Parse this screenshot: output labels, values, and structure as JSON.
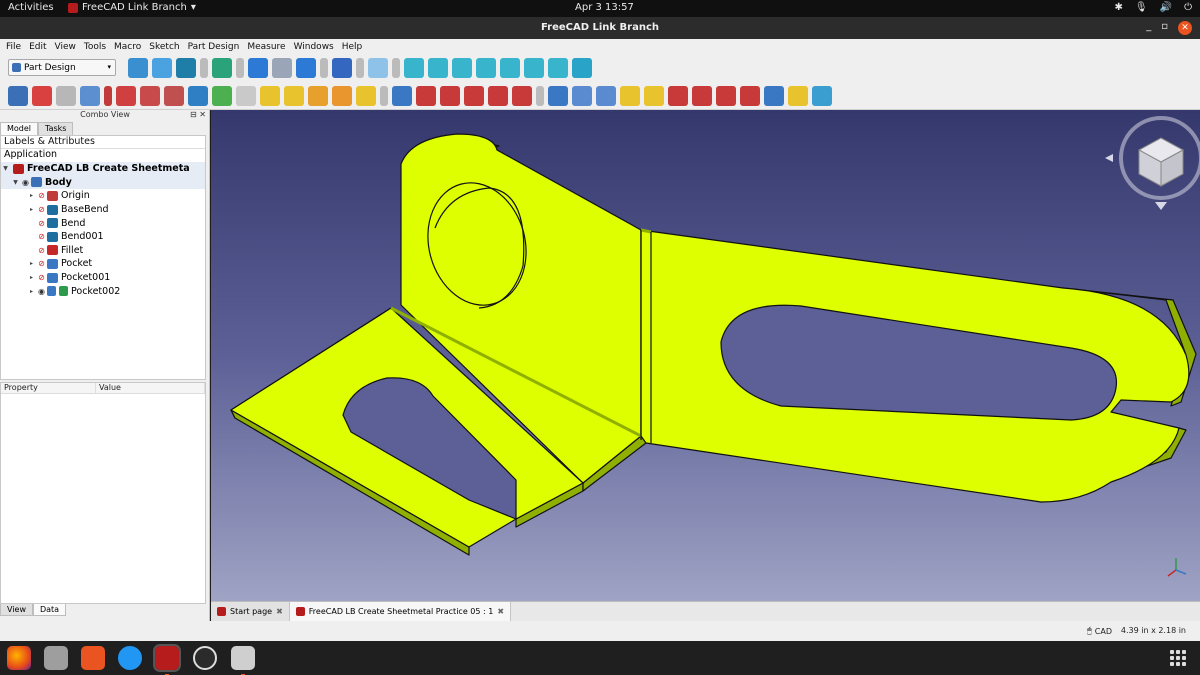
{
  "topbar": {
    "activities": "Activities",
    "app_name": "FreeCAD Link Branch",
    "app_caret": "▾",
    "clock": "Apr 3  13:57",
    "tray_icons": [
      "accessibility-icon",
      "microphone-icon",
      "volume-icon",
      "power-icon"
    ],
    "tray_glyphs": [
      "✱",
      "🎙",
      "🔊",
      "⏻"
    ]
  },
  "window": {
    "title": "FreeCAD Link Branch",
    "minimize": "_",
    "restore": "▫",
    "close": "✕"
  },
  "menu": [
    "File",
    "Edit",
    "View",
    "Tools",
    "Macro",
    "Sketch",
    "Part Design",
    "Measure",
    "Windows",
    "Help"
  ],
  "workbench": {
    "selected": "Part Design",
    "caret": "▾"
  },
  "combo": {
    "title": "Combo View",
    "controls": "⊟ ✕",
    "tabs": [
      "Model",
      "Tasks"
    ],
    "tree_header": "Labels & Attributes",
    "application": "Application",
    "document": "FreeCAD LB Create Sheetmeta",
    "body": "Body",
    "features": [
      {
        "label": "Origin",
        "visible": false,
        "expandable": true
      },
      {
        "label": "BaseBend",
        "visible": false,
        "expandable": true
      },
      {
        "label": "Bend",
        "visible": false,
        "expandable": false
      },
      {
        "label": "Bend001",
        "visible": false,
        "expandable": false
      },
      {
        "label": "Fillet",
        "visible": false,
        "expandable": false
      },
      {
        "label": "Pocket",
        "visible": false,
        "expandable": true
      },
      {
        "label": "Pocket001",
        "visible": false,
        "expandable": true
      },
      {
        "label": "Pocket002",
        "visible": true,
        "expandable": true
      }
    ],
    "prop_col_property": "Property",
    "prop_col_value": "Value",
    "bottom_tabs": [
      "View",
      "Data"
    ]
  },
  "doc_tabs": [
    {
      "label": "Start page",
      "close": "✖"
    },
    {
      "label": "FreeCAD LB Create Sheetmetal Practice 05 : 1",
      "close": "✖"
    }
  ],
  "status": {
    "nav_style": "CAD",
    "dimensions": "4.39 in x 2.18 in"
  },
  "colors": {
    "part_face": "#ddff00",
    "part_edge": "#111111",
    "viewport_top": "#35386c",
    "viewport_bottom": "#9fa3c4",
    "accent": "#e95420"
  },
  "dock": [
    "firefox-icon",
    "files-icon",
    "software-icon",
    "help-icon",
    "freecad-icon",
    "obs-icon",
    "screenshot-icon"
  ]
}
